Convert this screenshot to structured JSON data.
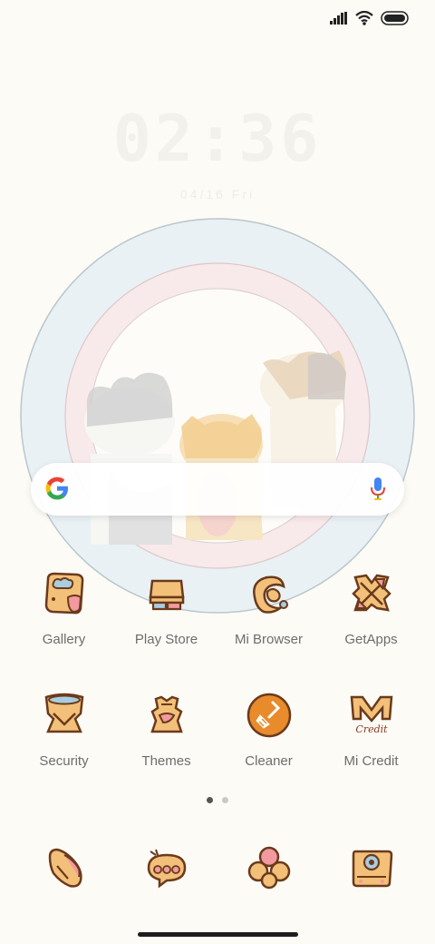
{
  "status": {
    "icons": [
      "signal-icon",
      "wifi-icon",
      "battery-icon"
    ]
  },
  "clock": {
    "time": "02:36",
    "date": "04/16 Fri"
  },
  "search": {
    "icons": [
      "google-icon",
      "microphone-icon"
    ]
  },
  "apps_row1": [
    {
      "label": "Gallery",
      "icon": "gallery-icon"
    },
    {
      "label": "Play Store",
      "icon": "play-store-icon"
    },
    {
      "label": "Mi Browser",
      "icon": "mi-browser-icon"
    },
    {
      "label": "GetApps",
      "icon": "getapps-icon"
    }
  ],
  "apps_row2": [
    {
      "label": "Security",
      "icon": "security-icon"
    },
    {
      "label": "Themes",
      "icon": "themes-icon"
    },
    {
      "label": "Cleaner",
      "icon": "cleaner-icon"
    },
    {
      "label": "Mi Credit",
      "icon": "mi-credit-icon"
    }
  ],
  "mi_credit_icon_text": "Credit",
  "dock": [
    {
      "icon": "phone-icon"
    },
    {
      "icon": "messages-icon"
    },
    {
      "icon": "app-vault-icon"
    },
    {
      "icon": "camera-icon"
    }
  ],
  "pager": {
    "pages": 2,
    "current": 1
  },
  "colors": {
    "background": "#fdfbf6",
    "icon_fill": "#f3c07a",
    "icon_outline": "#6b3a1b",
    "cleaner_accent": "#e88b2a"
  }
}
